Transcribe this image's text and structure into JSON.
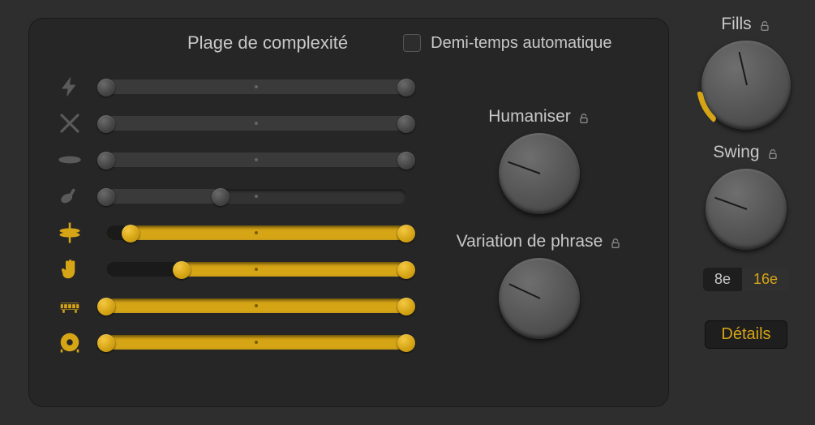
{
  "header": {
    "title": "Plage de complexité",
    "auto_halftime_label": "Demi-temps automatique",
    "auto_halftime_checked": false
  },
  "rows": [
    {
      "icon": "lightning",
      "active": false,
      "low": 0,
      "high": 100
    },
    {
      "icon": "drumsticks",
      "active": false,
      "low": 0,
      "high": 100
    },
    {
      "icon": "cymbal",
      "active": false,
      "low": 0,
      "high": 100
    },
    {
      "icon": "shaker",
      "active": false,
      "low": 0,
      "high": 38
    },
    {
      "icon": "hihat",
      "active": true,
      "low": 8,
      "high": 100
    },
    {
      "icon": "hand",
      "active": true,
      "low": 25,
      "high": 100
    },
    {
      "icon": "snare",
      "active": true,
      "low": 0,
      "high": 100
    },
    {
      "icon": "kick",
      "active": true,
      "low": 0,
      "high": 100
    }
  ],
  "knobs": {
    "humanize": {
      "label": "Humaniser",
      "angle": 200
    },
    "phrase": {
      "label": "Variation de phrase",
      "angle": 205
    },
    "fills": {
      "label": "Fills",
      "angle": 257,
      "arc_start": 225,
      "arc_end": 258
    },
    "swing": {
      "label": "Swing",
      "angle": 200
    }
  },
  "segmented": {
    "option_a": "8e",
    "option_b": "16e",
    "active": "b"
  },
  "details_label": "Détails"
}
